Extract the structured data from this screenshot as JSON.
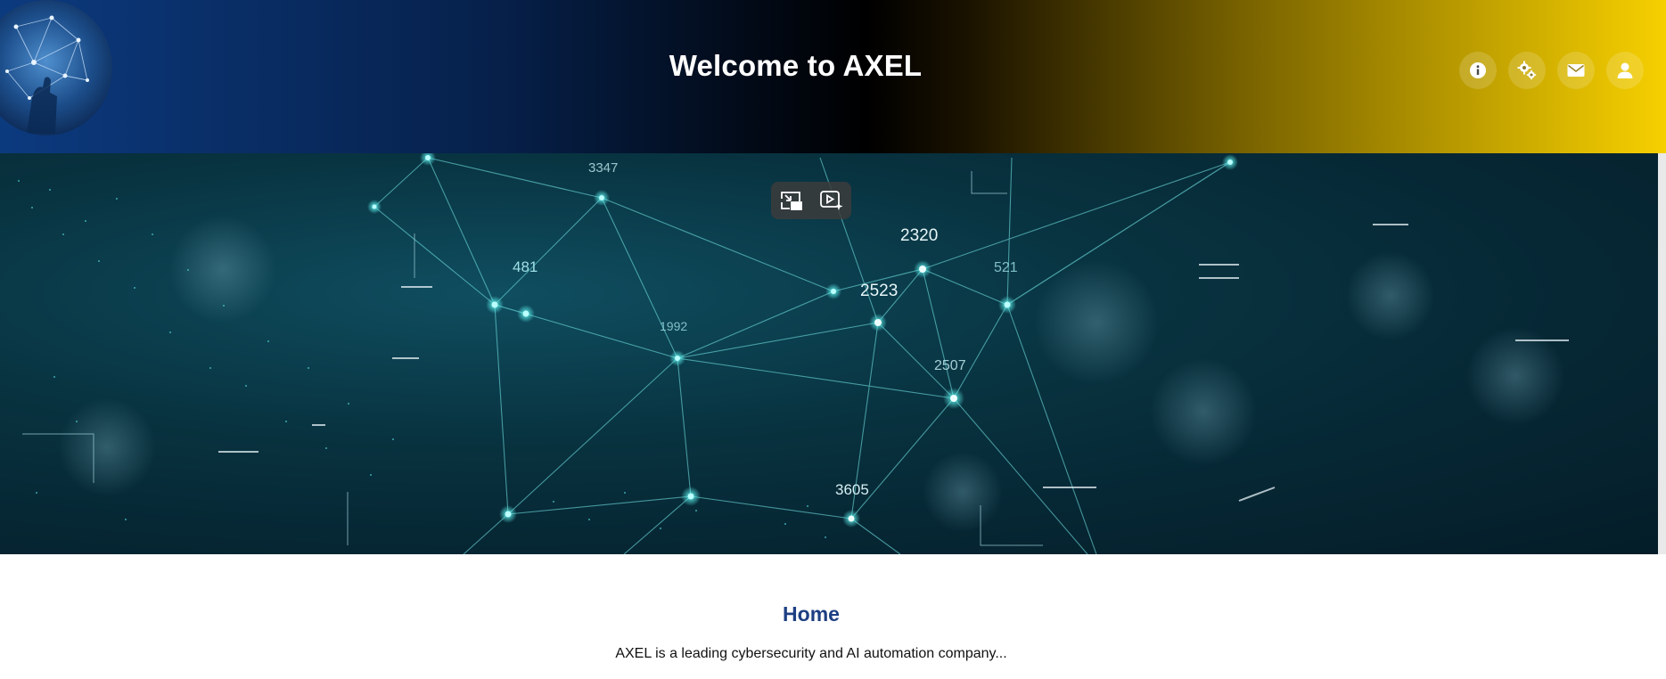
{
  "header": {
    "title": "Welcome to AXEL",
    "logo_icon": "network-hand-logo",
    "actions": [
      {
        "icon": "info-icon",
        "label": "About"
      },
      {
        "icon": "gears-icon",
        "label": "Services"
      },
      {
        "icon": "envelope-icon",
        "label": "Contact"
      },
      {
        "icon": "user-icon",
        "label": "Account"
      }
    ],
    "colors": {
      "start": "#0c3a7f",
      "middle": "#000000",
      "end": "#f7d000"
    }
  },
  "hero": {
    "image": "network-graph-background",
    "node_labels": [
      "3347",
      "2320",
      "2523",
      "481",
      "1992",
      "2507",
      "3605",
      "521"
    ],
    "overlay_controls": [
      {
        "icon": "exit-picture-in-picture-icon"
      },
      {
        "icon": "video-sparkle-icon"
      }
    ]
  },
  "main": {
    "heading": "Home",
    "description": "AXEL is a leading cybersecurity and AI automation company...",
    "heading_color": "#1d3f82"
  }
}
